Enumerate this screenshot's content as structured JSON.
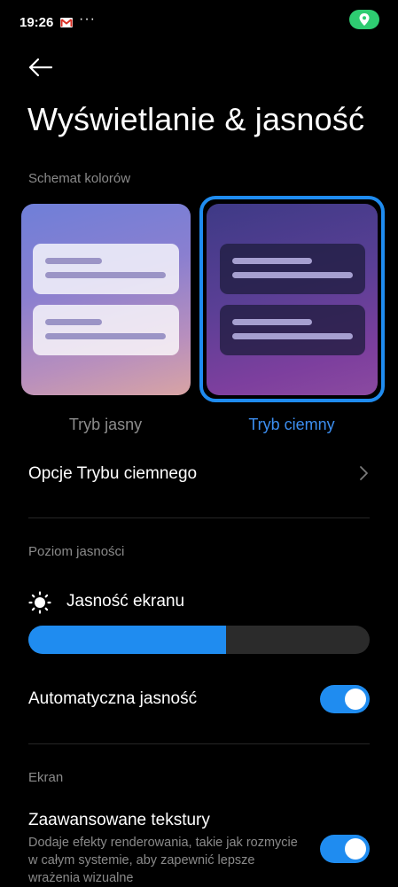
{
  "status_bar": {
    "time": "19:26",
    "more": "···",
    "icons": [
      "gmail-icon",
      "location-icon"
    ],
    "location_color": "#2ecc71"
  },
  "header": {
    "back_icon": "arrow-left-icon",
    "title": "Wyświetlanie & jasność"
  },
  "color_scheme": {
    "section_label": "Schemat kolorów",
    "options": [
      {
        "label": "Tryb jasny",
        "selected": false
      },
      {
        "label": "Tryb ciemny",
        "selected": true
      }
    ],
    "accent_color": "#1f8cf0"
  },
  "dark_mode_options": {
    "label": "Opcje Trybu ciemnego",
    "icon": "chevron-right-icon"
  },
  "brightness": {
    "section_label": "Poziom jasności",
    "screen_brightness_label": "Jasność ekranu",
    "icon": "sun-icon",
    "level_percent": 58
  },
  "auto_brightness": {
    "label": "Automatyczna jasność",
    "enabled": true
  },
  "screen": {
    "section_label": "Ekran",
    "advanced_textures": {
      "label": "Zaawansowane tekstury",
      "description": "Dodaje efekty renderowania, takie jak rozmycie w całym systemie, aby zapewnić lepsze wrażenia wizualne",
      "enabled": true
    }
  }
}
